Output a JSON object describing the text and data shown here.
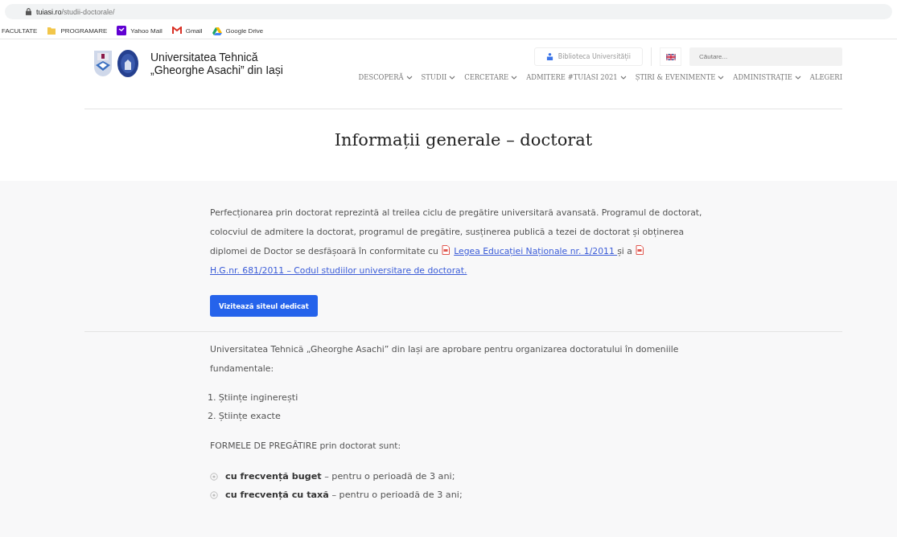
{
  "browser": {
    "address": {
      "domain": "tuiasi.ro",
      "path": "/studii-doctorale/"
    },
    "bookmarks": [
      {
        "label": "FACULTATE",
        "kind": "none"
      },
      {
        "label": "PROGRAMARE",
        "kind": "folder"
      },
      {
        "label": "Yahoo Mail",
        "kind": "yahoo"
      },
      {
        "label": "Gmail",
        "kind": "gmail"
      },
      {
        "label": "Google Drive",
        "kind": "drive"
      }
    ]
  },
  "header": {
    "title_lines": [
      "Universitatea Tehnică",
      "„Gheorghe Asachi” din Iași"
    ],
    "library_button": "Biblioteca Universității",
    "search": {
      "placeholder": "Căutare..."
    },
    "nav": [
      {
        "label": "DESCOPERĂ",
        "dropdown": true
      },
      {
        "label": "STUDII",
        "dropdown": true
      },
      {
        "label": "CERCETARE",
        "dropdown": true
      },
      {
        "label": "ADMITERE #TUIASI 2021",
        "dropdown": true
      },
      {
        "label": "ȘTIRI & EVENIMENTE",
        "dropdown": true
      },
      {
        "label": "ADMINISTRAȚIE",
        "dropdown": true
      },
      {
        "label": "ALEGERI",
        "dropdown": false
      }
    ]
  },
  "page_title": "Informații generale – doctorat",
  "intro": [
    {
      "kind": "text",
      "text": "Perfecționarea prin doctorat reprezintă al treilea ciclu de pregătire universitară avansată. Programul de doctorat, colocviul de admitere la doctorat, programul de pregătire, susținerea publică a tezei de doctorat și obținerea diplomei de Doctor se desfășoară în conformitate cu "
    },
    {
      "kind": "pdf_link",
      "text": "Legea Educației Naționale nr. 1/2011 "
    },
    {
      "kind": "text",
      "text": "și a "
    },
    {
      "kind": "pdf_link",
      "text": "H.G.nr. 681/2011 – Codul studiilor universitare de doctorat."
    }
  ],
  "visit_button": "Vizitează siteul dedicat",
  "domains_text": "Universitatea Tehnică „Gheorghe Asachi” din Iași are aprobare pentru organizarea doctoratului în domeniile fundamentale:",
  "domains": [
    {
      "number": "1.",
      "text": "Științe inginerești"
    },
    {
      "number": "2.",
      "text": "Științe exacte"
    }
  ],
  "forms_heading": "FORMELE DE PREGĂTIRE prin doctorat sunt:",
  "forms": [
    "**cu frecvență buget** – pentru o perioadă de 3 ani;",
    "**cu frecvență cu taxă** – pentru o perioadă de 3 ani;"
  ]
}
